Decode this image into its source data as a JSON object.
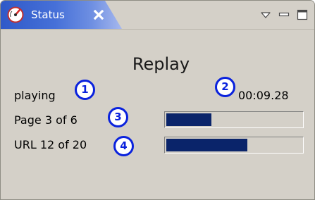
{
  "view": {
    "title": "Status",
    "icon": "gauge-icon"
  },
  "window_controls": [
    {
      "name": "view-menu-icon",
      "symbol": "triangle-down"
    },
    {
      "name": "minimize-icon",
      "symbol": "minimize"
    },
    {
      "name": "maximize-icon",
      "symbol": "maximize"
    }
  ],
  "replay": {
    "heading": "Replay",
    "state": "playing",
    "elapsed": "00:09.28",
    "page_label": "Page 3 of 6",
    "page_progress": 0.333,
    "url_label": "URL 12 of 20",
    "url_progress": 0.6
  },
  "callouts": [
    "1",
    "2",
    "3",
    "4"
  ],
  "colors": {
    "callout": "#0a22dd",
    "progress_fill": "#0a246a",
    "tab_gradient_start": "#2f59c8",
    "panel_bg": "#d4d0c8"
  }
}
